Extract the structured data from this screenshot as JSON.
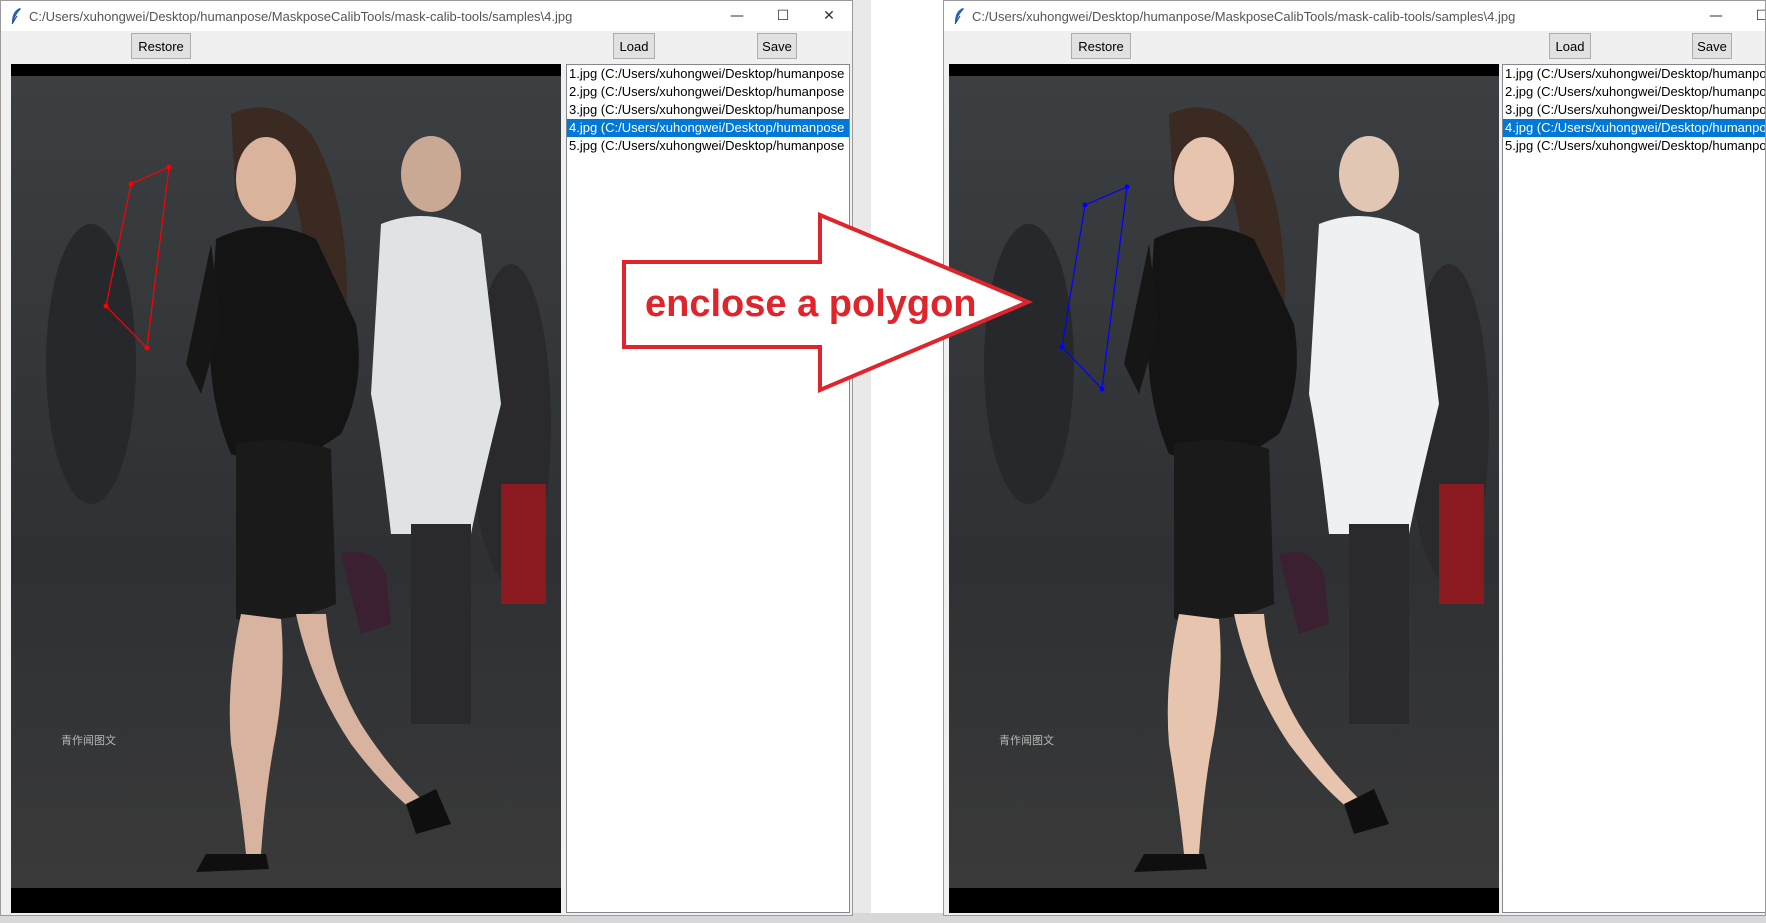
{
  "left_window": {
    "title": "C:/Users/xuhongwei/Desktop/humanpose/MaskposeCalibTools/mask-calib-tools/samples\\4.jpg",
    "controls": {
      "minimize": "—",
      "maximize": "☐",
      "close": "✕"
    },
    "buttons": {
      "restore": "Restore",
      "load": "Load",
      "save": "Save"
    },
    "files": [
      "1.jpg (C:/Users/xuhongwei/Desktop/humanpose",
      "2.jpg (C:/Users/xuhongwei/Desktop/humanpose",
      "3.jpg (C:/Users/xuhongwei/Desktop/humanpose",
      "4.jpg (C:/Users/xuhongwei/Desktop/humanpose",
      "5.jpg (C:/Users/xuhongwei/Desktop/humanpose"
    ],
    "selected_index": 3,
    "polygon_color": "#ff0000"
  },
  "right_window": {
    "title": "C:/Users/xuhongwei/Desktop/humanpose/MaskposeCalibTools/mask-calib-tools/samples\\4.jpg",
    "controls": {
      "minimize": "—",
      "maximize": "☐"
    },
    "buttons": {
      "restore": "Restore",
      "load": "Load",
      "save": "Save"
    },
    "files": [
      "1.jpg (C:/Users/xuhongwei/Desktop/humanpo",
      "2.jpg (C:/Users/xuhongwei/Desktop/humanpo",
      "3.jpg (C:/Users/xuhongwei/Desktop/humanpo",
      "4.jpg (C:/Users/xuhongwei/Desktop/humanpo",
      "5.jpg (C:/Users/xuhongwei/Desktop/humanpo"
    ],
    "selected_index": 3,
    "polygon_color": "#0000ff"
  },
  "annotation": {
    "text": "enclose a polygon",
    "color": "#e0242b"
  },
  "colors": {
    "selection": "#0078d7",
    "canvas_bg": "#000000",
    "window_bg": "#f0f0f0"
  }
}
